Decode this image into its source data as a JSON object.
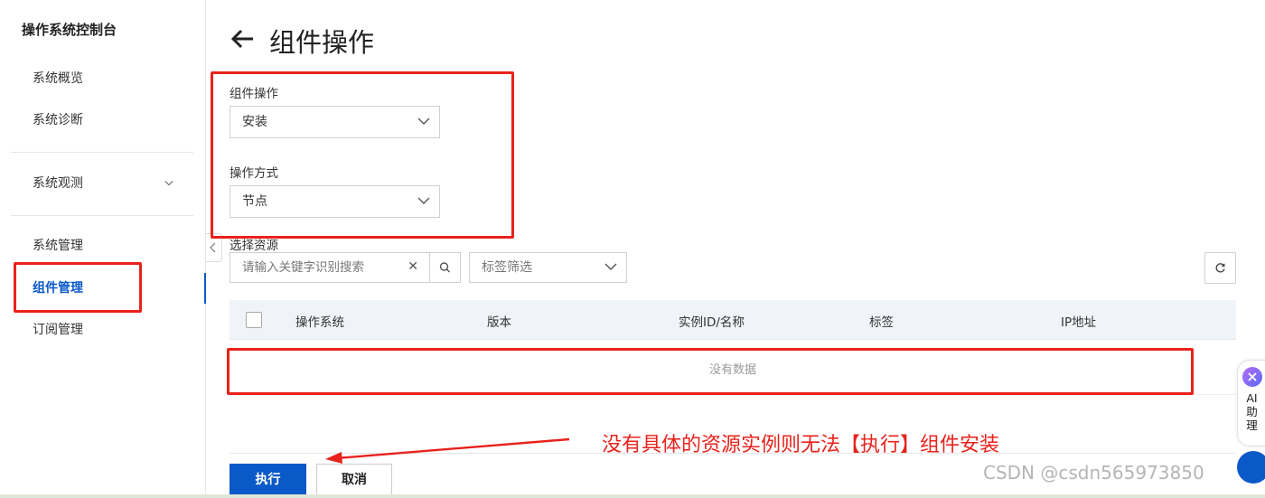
{
  "sidebar": {
    "title": "操作系统控制台",
    "items": [
      {
        "label": "系统概览"
      },
      {
        "label": "系统诊断"
      },
      {
        "label": "系统观测"
      },
      {
        "label": "系统管理"
      },
      {
        "label": "组件管理"
      },
      {
        "label": "订阅管理"
      }
    ],
    "active_item": "组件管理"
  },
  "header": {
    "title": "组件操作"
  },
  "form": {
    "operation_label": "组件操作",
    "operation_value": "安装",
    "method_label": "操作方式",
    "method_value": "节点",
    "resource_label": "选择资源",
    "search_placeholder": "请输入关键字识别搜索",
    "tag_filter_placeholder": "标签筛选"
  },
  "table": {
    "columns": [
      "操作系统",
      "版本",
      "实例ID/名称",
      "标签",
      "IP地址"
    ],
    "rows": [],
    "empty_text": "没有数据"
  },
  "actions": {
    "execute_label": "执行",
    "cancel_label": "取消"
  },
  "annotation": {
    "text": "没有具体的资源实例则无法【执行】组件安装",
    "color": "#e8221c"
  },
  "ai_helper": {
    "label": "AI\n助\n理"
  },
  "watermark": "CSDN @csdn565973850",
  "colors": {
    "primary": "#0a59c8",
    "annotation": "#e8221c"
  }
}
